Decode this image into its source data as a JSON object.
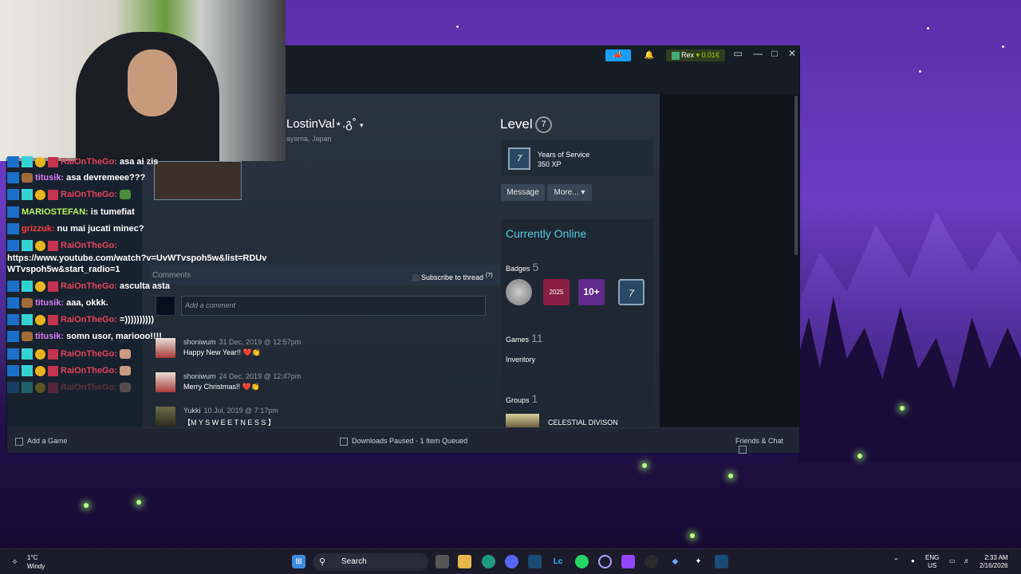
{
  "steam": {
    "persona_name": "LostinVal⋆.გ˚",
    "location": "ayama, Japan",
    "topbar": {
      "profile_name": "Rex",
      "wallet": "0.01€"
    },
    "level": {
      "label": "Level",
      "value": "7"
    },
    "featured_badge": {
      "icon_text": "7",
      "name": "Years of Service",
      "xp": "350 XP"
    },
    "buttons": {
      "message": "Message",
      "more": "More... ▾"
    },
    "status": "Currently Online",
    "badges": {
      "label": "Badges",
      "count": "5",
      "items": [
        {
          "name": "coin-badge-icon",
          "text": ""
        },
        {
          "name": "steam-2025-badge-icon",
          "text": "2025"
        },
        {
          "name": "ten-plus-badge-icon",
          "text": "10+"
        },
        {
          "name": "years-badge-icon",
          "text": "7"
        }
      ]
    },
    "games": {
      "label": "Games",
      "count": "11"
    },
    "inventory": "Inventory",
    "groups": {
      "label": "Groups",
      "count": "1",
      "first_group": "CELESTIAL DIVISON"
    },
    "comments": {
      "label": "Comments",
      "subscribe": "Subscribe to thread",
      "subscribe_help": "(?)",
      "placeholder": "Add a comment",
      "items": [
        {
          "author": "shoniwum",
          "time": "31 Dec, 2019 @ 12:57pm",
          "text": "Happy New Year!! ❤️👏"
        },
        {
          "author": "shoniwum",
          "time": "24 Dec, 2019 @ 12:47pm",
          "text": "Merry Christmas!! ❤️👏"
        },
        {
          "author": "Yukki",
          "time": "10 Jul, 2019 @ 7:17pm",
          "text": "【M Y  S W E E T N E S S 】"
        }
      ]
    },
    "bottombar": {
      "add_game": "Add a Game",
      "downloads": "Downloads Paused - 1 Item Queued",
      "friends": "Friends & Chat"
    }
  },
  "chat": {
    "messages": [
      {
        "user": "RaiOnTheGo:",
        "text": "asa ai zis",
        "user_color": "#e0445a"
      },
      {
        "user": "titusik:",
        "text": "asa devremeee???",
        "user_color": "#d57df0"
      },
      {
        "user": "RaiOnTheGo:",
        "text": "",
        "user_color": "#e0445a"
      },
      {
        "user": "MARIOSTEFAN:",
        "text": "is tumefiat",
        "user_color": "#b8f05a"
      },
      {
        "user": "grizzuk:",
        "text": "nu mai jucati minec?",
        "user_color": "#ff3b3b"
      },
      {
        "user": "RaiOnTheGo:",
        "text": "https://www.youtube.com/watch?v=UvWTvspoh5w&list=RDUvWTvspoh5w&start_radio=1",
        "user_color": "#e0445a"
      },
      {
        "user": "RaiOnTheGo:",
        "text": "asculta asta",
        "user_color": "#e0445a"
      },
      {
        "user": "titusik:",
        "text": "aaa, okkk.",
        "user_color": "#d57df0"
      },
      {
        "user": "RaiOnTheGo:",
        "text": "=))))))))))",
        "user_color": "#e0445a"
      },
      {
        "user": "titusik:",
        "text": "somn usor, mariooo!!!!",
        "user_color": "#d57df0"
      },
      {
        "user": "RaiOnTheGo:",
        "text": "",
        "user_color": "#e0445a"
      },
      {
        "user": "RaiOnTheGo:",
        "text": "",
        "user_color": "#e0445a"
      },
      {
        "user": "RaiOnTheGo:",
        "text": "",
        "user_color": "#e0445a"
      }
    ]
  },
  "taskbar": {
    "weather_temp": "1°C",
    "weather_desc": "Windy",
    "search": "Search",
    "lang_top": "ENG",
    "lang_bottom": "US",
    "time": "2:33 AM",
    "date": "2/16/2026"
  },
  "colors": {
    "steam_bg": "#1b2838",
    "online_accent": "#57cbde",
    "announce_blue": "#1a9fff",
    "wallet_green": "#a4d007"
  }
}
